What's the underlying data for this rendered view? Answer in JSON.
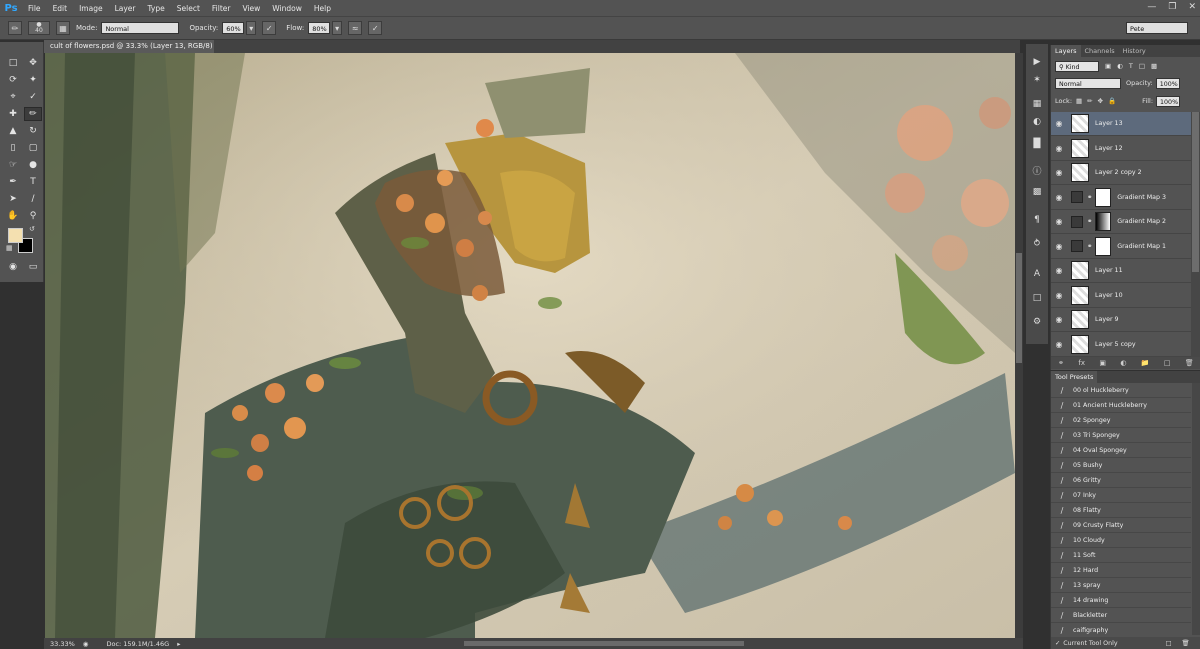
{
  "app": {
    "logo": "Ps",
    "workspace": "Pete"
  },
  "menu": [
    "File",
    "Edit",
    "Image",
    "Layer",
    "Type",
    "Select",
    "Filter",
    "View",
    "Window",
    "Help"
  ],
  "options": {
    "brush_size": "40",
    "mode_label": "Mode:",
    "mode_value": "Normal",
    "opacity_label": "Opacity:",
    "opacity_value": "60%",
    "flow_label": "Flow:",
    "flow_value": "80%"
  },
  "document": {
    "tab_title": "cult of flowers.psd @ 33.3% (Layer 13, RGB/8) *"
  },
  "status": {
    "zoom": "33.33%",
    "doc": "Doc: 159.1M/1.46G"
  },
  "layers_panel": {
    "tabs": [
      "Layers",
      "Channels",
      "History"
    ],
    "kind": "Kind",
    "blend_mode": "Normal",
    "opacity_label": "Opacity:",
    "opacity_value": "100%",
    "lock_label": "Lock:",
    "fill_label": "Fill:",
    "fill_value": "100%",
    "layers": [
      {
        "name": "Layer 13",
        "kind": "pixel",
        "selected": true
      },
      {
        "name": "Layer 12",
        "kind": "pixel",
        "selected": false
      },
      {
        "name": "Layer 2 copy 2",
        "kind": "pixel",
        "selected": false
      },
      {
        "name": "Gradient Map 3",
        "kind": "adjustment",
        "selected": false
      },
      {
        "name": "Gradient Map 2",
        "kind": "adjustment",
        "selected": false
      },
      {
        "name": "Gradient Map 1",
        "kind": "adjustment",
        "selected": false
      },
      {
        "name": "Layer 11",
        "kind": "pixel",
        "selected": false
      },
      {
        "name": "Layer 10",
        "kind": "pixel",
        "selected": false
      },
      {
        "name": "Layer 9",
        "kind": "pixel",
        "selected": false
      },
      {
        "name": "Layer 5 copy",
        "kind": "pixel",
        "selected": false
      }
    ]
  },
  "presets_panel": {
    "title": "Tool Presets",
    "items": [
      "00 ol Huckleberry",
      "01 Ancient Huckleberry",
      "02 Spongey",
      "03 Tri Spongey",
      "04 Oval Spongey",
      "05 Bushy",
      "06 Gritty",
      "07 Inky",
      "08 Flatty",
      "09 Crusty Flatty",
      "10 Cloudy",
      "11 Soft",
      "12 Hard",
      "13 spray",
      "14 drawing",
      "Blackletter",
      "caifigraphy"
    ],
    "footer_label": "Current Tool Only"
  },
  "colors": {
    "foreground": "#f4e0b0",
    "background": "#000000",
    "selection": "#5d6a7c"
  }
}
